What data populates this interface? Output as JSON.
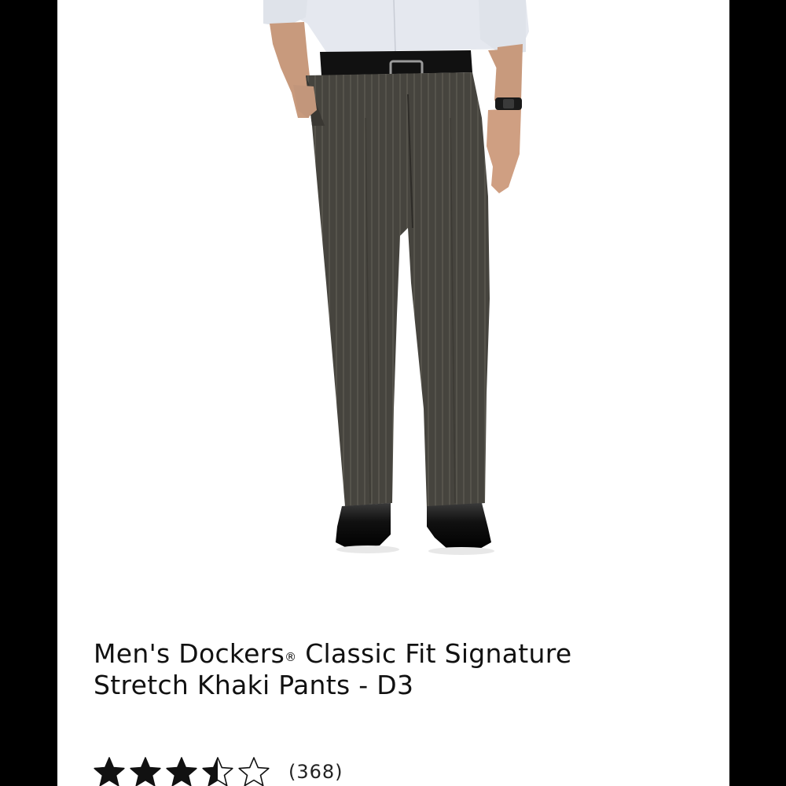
{
  "product": {
    "title_main": "Men's Dockers",
    "title_reg": "®",
    "title_rest": " Classic Fit Signature",
    "title_line2": "Stretch Khaki Pants - D3",
    "image_icon": "product-photo-pinstripe-pants"
  },
  "rating": {
    "value": 3.5,
    "max": 5,
    "review_count_label": "(368)"
  },
  "colors": {
    "frame": "#000000",
    "background": "#ffffff",
    "pants": "#45433d",
    "shirt": "#e6e9f0",
    "shoes": "#0d0d0d",
    "star": "#111111"
  }
}
